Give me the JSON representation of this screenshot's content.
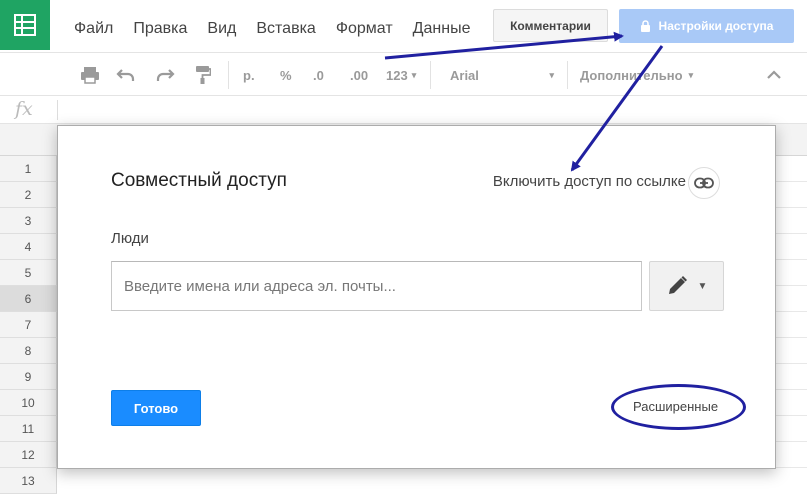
{
  "menu": {
    "items": [
      "Файл",
      "Правка",
      "Вид",
      "Вставка",
      "Формат",
      "Данные"
    ]
  },
  "header": {
    "comments_label": "Комментарии",
    "share_label": "Настройки доступа"
  },
  "toolbar": {
    "currency": "р.",
    "percent": "%",
    "decrease_decimals": ".0",
    "increase_decimals": ".00",
    "number_format": "123",
    "font": "Arial",
    "more": "Дополнительно"
  },
  "formula_bar": {
    "fx_label": "fx"
  },
  "grid": {
    "rows": [
      "1",
      "2",
      "3",
      "4",
      "5",
      "6",
      "7",
      "8",
      "9",
      "10",
      "11",
      "12",
      "13"
    ],
    "active_row": "6"
  },
  "dialog": {
    "title": "Совместный доступ",
    "link_sharing_label": "Включить доступ по ссылке",
    "people_label": "Люди",
    "people_placeholder": "Введите имена или адреса эл. почты...",
    "done_label": "Готово",
    "advanced_label": "Расширенные"
  },
  "colors": {
    "logo": "#1fa463",
    "share_button": "#a9c9f7",
    "done_button": "#1a8cff",
    "annotation": "#2020a0"
  },
  "icons": {
    "logo": "sheets-logo-icon",
    "lock": "lock-icon",
    "print": "print-icon",
    "undo": "undo-icon",
    "redo": "redo-icon",
    "paint": "paint-format-icon",
    "link": "link-icon",
    "pencil": "pencil-icon",
    "caret": "caret-down-icon",
    "collapse": "chevron-up-icon"
  }
}
